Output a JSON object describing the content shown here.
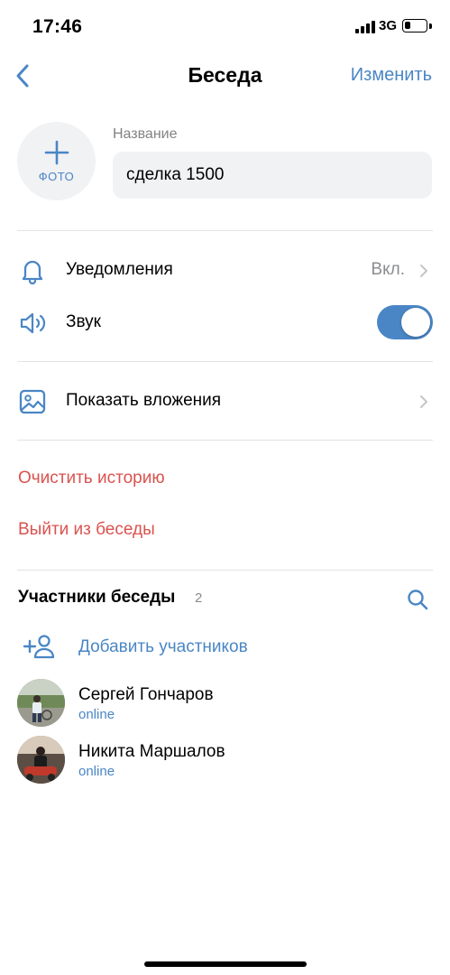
{
  "status_bar": {
    "time": "17:46",
    "network": "3G",
    "signal_bars": 4,
    "battery_level": 0.3
  },
  "nav": {
    "title": "Беседа",
    "edit_label": "Изменить",
    "back_icon": "chevron-left-icon"
  },
  "chat_info": {
    "photo_label": "ФОТО",
    "name_label": "Название",
    "name_value": "сделка 1500"
  },
  "settings": {
    "notifications": {
      "label": "Уведомления",
      "value": "Вкл.",
      "icon": "bell-icon"
    },
    "sound": {
      "label": "Звук",
      "enabled": true,
      "icon": "speaker-icon"
    },
    "attachments": {
      "label": "Показать вложения",
      "icon": "image-icon"
    }
  },
  "actions": {
    "clear_history": "Очистить историю",
    "leave_chat": "Выйти из беседы"
  },
  "members": {
    "title": "Участники беседы",
    "count": "2",
    "add_label": "Добавить участников",
    "list": [
      {
        "name": "Сергей Гончаров",
        "status": "online"
      },
      {
        "name": "Никита Маршалов",
        "status": "online"
      }
    ]
  },
  "colors": {
    "accent": "#4a86c5",
    "danger": "#d9534f",
    "secondary_text": "#8a8c90",
    "field_background": "#f1f2f4",
    "divider": "#e2e3e6"
  }
}
